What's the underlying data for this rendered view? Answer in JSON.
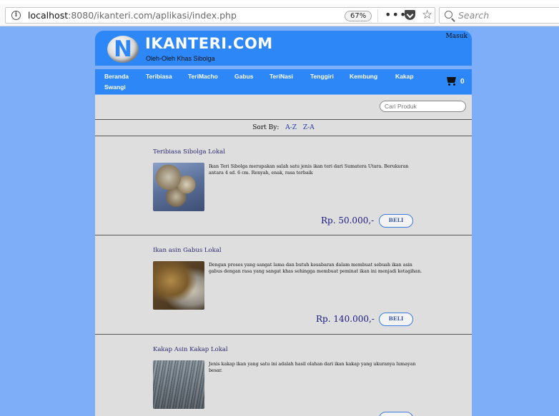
{
  "browser": {
    "url_host": "localhost",
    "url_rest": ":8080/ikanteri.com/aplikasi/index.php",
    "zoom": "67%",
    "more_icon": "•••",
    "star_icon": "☆",
    "search_placeholder": "Search"
  },
  "header": {
    "logo_letter": "N",
    "site_title": "IKANTERI.COM",
    "tagline": "Oleh-Oleh Khas Sibolga",
    "login_link": "Masuk"
  },
  "nav": {
    "items": [
      "Beranda",
      "Teribiasa",
      "TeriMacho",
      "Gabus",
      "TeriNasi",
      "Tenggiri",
      "Kembung",
      "Kakap",
      "Swangi"
    ],
    "cart_count": "0"
  },
  "main": {
    "search_placeholder": "Cari Produk",
    "sort_label": "Sort By:",
    "sort_options": [
      "A-Z",
      "Z-A"
    ],
    "products": [
      {
        "title": "Teribiasa Sibolga Lokal",
        "description": "Ikan Teri Sibolga merupakan salah satu jenis ikan teri dari Sumatera Utara. Berukuran antara 4 sd. 6 cm. Renyah, enak, rasa terbaik",
        "price": "Rp. 50.000,-",
        "button": "BELI"
      },
      {
        "title": "Ikan asin Gabus Lokal",
        "description": "Dengan proses yang sangat lama dan butuh kesabaran dalam membuat sebuah ikan asin gabus dengan rasa yang sangat khas sehingga membuat peminat ikan ini menjadi ketagihan.",
        "price": "Rp. 140.000,-",
        "button": "BELI"
      },
      {
        "title": "Kakap Asin  Kakap Lokal",
        "description": "Jenis kakap ikan yang satu ini adalah hasil olahan dari ikan kakap yang ukuranya lumayan besar.",
        "price": "",
        "button": ""
      }
    ]
  }
}
